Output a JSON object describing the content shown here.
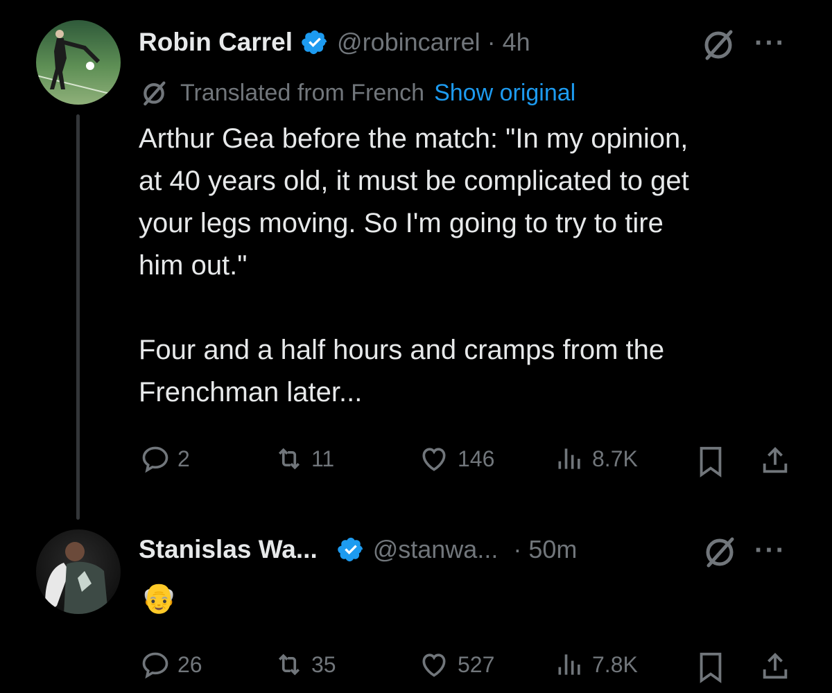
{
  "tweet1": {
    "author_name": "Robin Carrel",
    "handle": "@robincarrel",
    "time": "· 4h",
    "more": "···",
    "translated_label": "Translated from French",
    "show_original": "Show original",
    "body_lines": [
      "Arthur Gea before the match: \"In my opinion,",
      "at 40 years old, it must be complicated to get",
      "your legs moving. So I'm going to try to tire",
      "him out.\"",
      "",
      "Four and a half hours and cramps from the",
      "Frenchman later..."
    ],
    "stats": {
      "replies": "2",
      "reposts": "11",
      "likes": "146",
      "views": "8.7K"
    }
  },
  "tweet2": {
    "author_name": "Stanislas Wa...",
    "handle": "@stanwa...",
    "time": "· 50m",
    "more": "···",
    "body_emoji": "👴",
    "stats": {
      "replies": "26",
      "reposts": "35",
      "likes": "527",
      "views": "7.8K"
    }
  },
  "colors": {
    "background": "#000000",
    "text": "#e7e9ea",
    "muted": "#71767b",
    "link": "#1d9bf0",
    "verified": "#1d9bf0"
  },
  "icons": [
    "reply-icon",
    "repost-icon",
    "like-icon",
    "views-icon",
    "bookmark-icon",
    "share-icon",
    "verified-badge-icon",
    "grok-icon",
    "translate-icon"
  ]
}
